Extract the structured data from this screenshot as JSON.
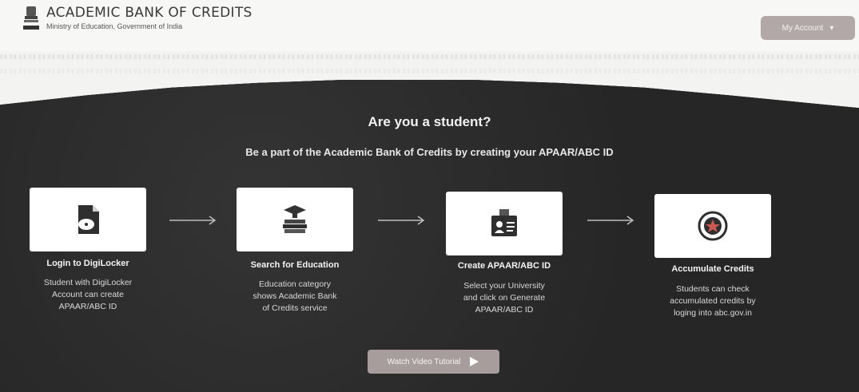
{
  "header": {
    "title": "ACADEMIC BANK OF CREDITS",
    "subtitle": "Ministry of Education, Government of India",
    "account_button": "My Account"
  },
  "hero": {
    "headline": "Are you a student?",
    "subline": "Be a part of the Academic Bank of Credits by creating your APAAR/ABC ID"
  },
  "steps": [
    {
      "icon": "digilocker-icon",
      "title": "Login to DigiLocker",
      "desc": "Student with DigiLocker\nAccount can create\nAPAAR/ABC ID"
    },
    {
      "icon": "books-icon",
      "title": "Search for Education",
      "desc": "Education category\nshows Academic Bank\nof Credits service"
    },
    {
      "icon": "id-card-icon",
      "title": "Create APAAR/ABC ID",
      "desc": "Select your University\nand click on Generate\nAPAAR/ABC ID"
    },
    {
      "icon": "star-badge-icon",
      "title": "Accumulate Credits",
      "desc": "Students can check\naccumulated credits by\nloging into abc.gov.in"
    }
  ],
  "video_button": "Watch Video Tutorial",
  "colors": {
    "panel": "#2b2b2b",
    "button": "#a89d9d",
    "accent_red": "#c85a52"
  }
}
